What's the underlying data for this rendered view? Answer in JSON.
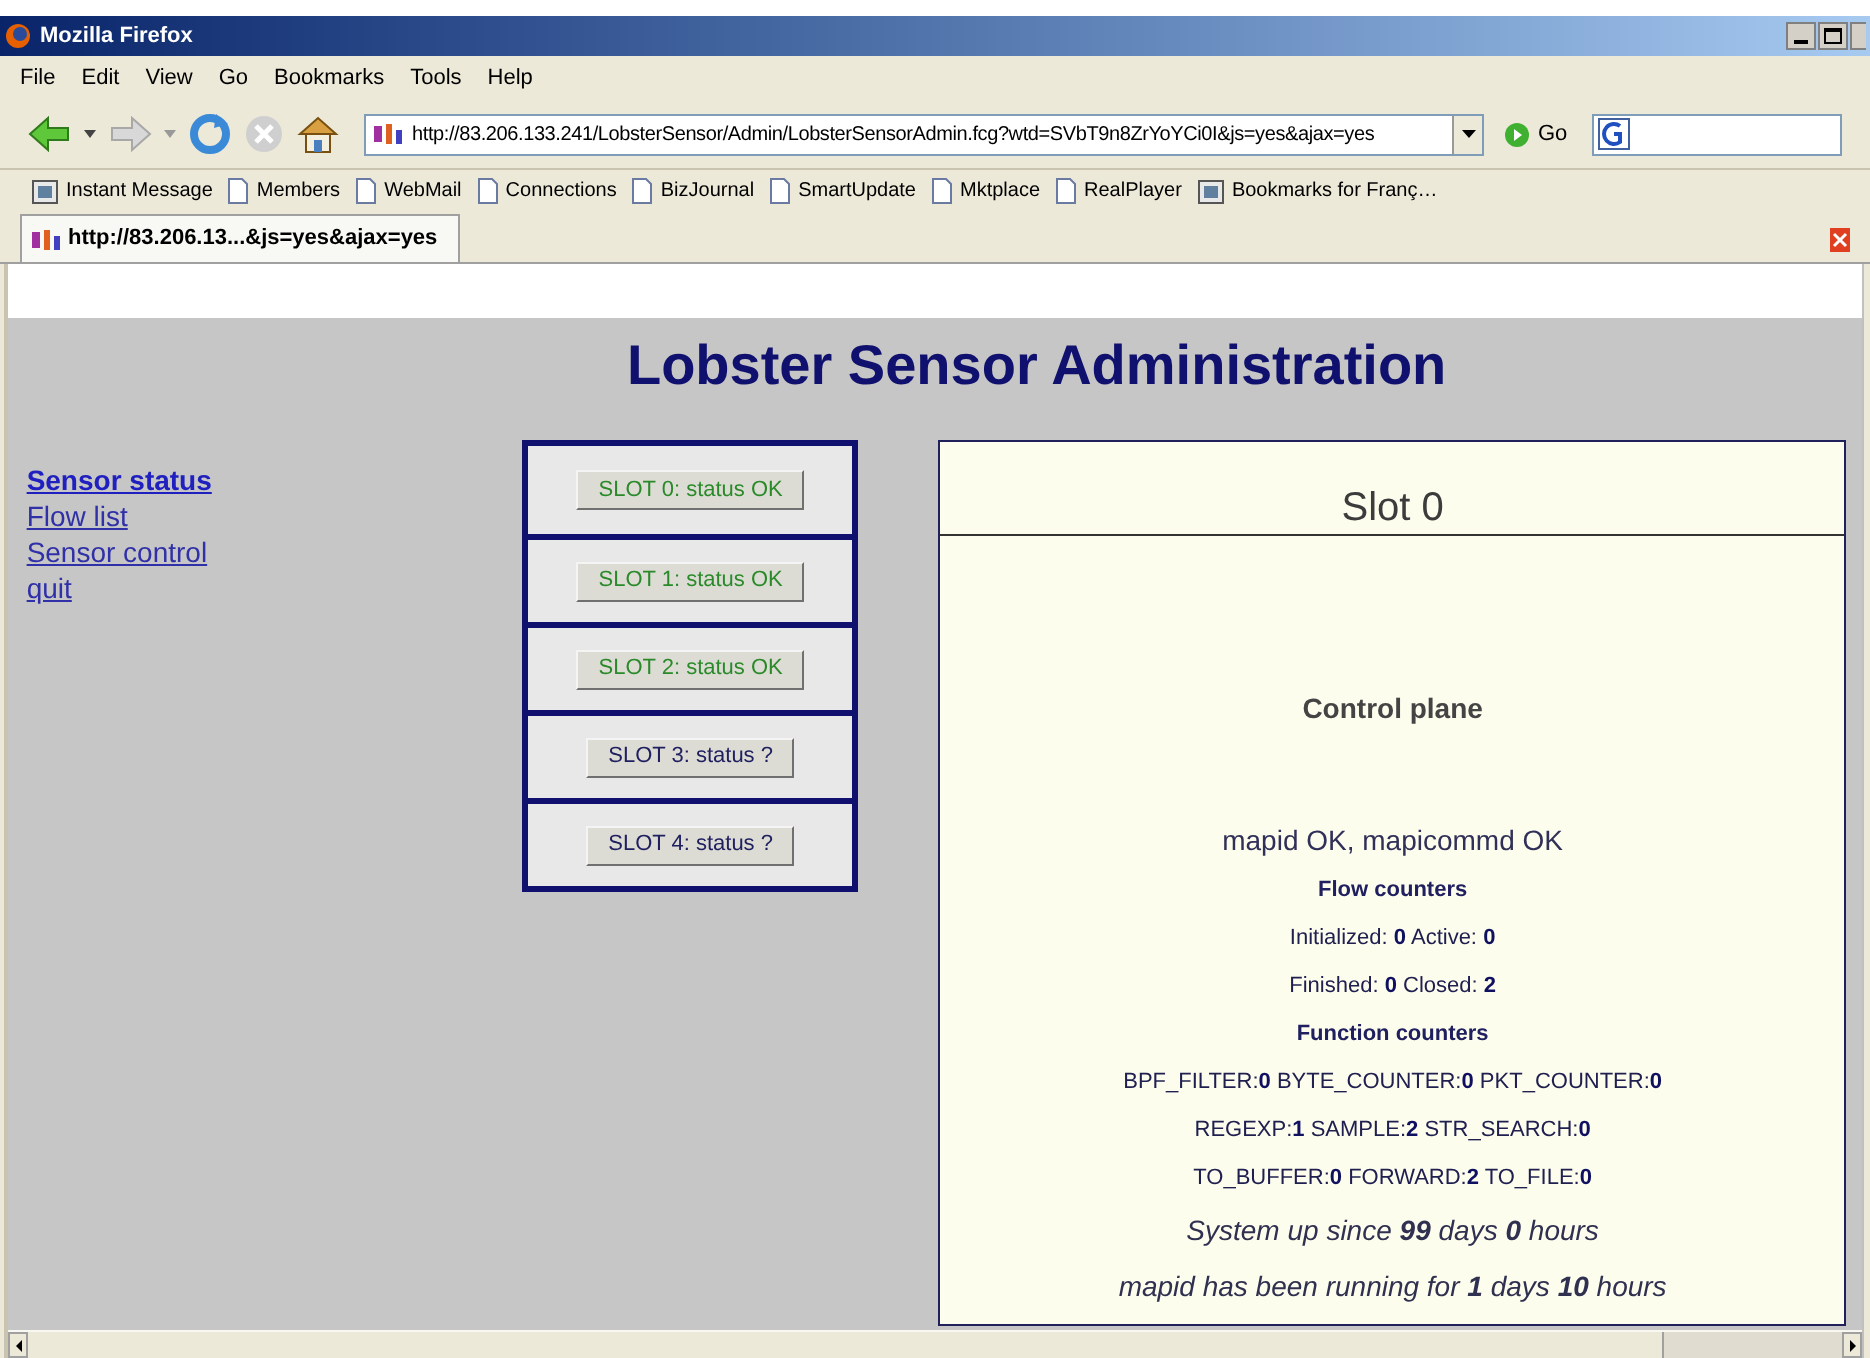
{
  "window": {
    "title": "Mozilla Firefox"
  },
  "menu": [
    "File",
    "Edit",
    "View",
    "Go",
    "Bookmarks",
    "Tools",
    "Help"
  ],
  "address": {
    "value": "http://83.206.133.241/LobsterSensor/Admin/LobsterSensorAdmin.fcg?wtd=SVbT9n8ZrYoYCi0I&js=yes&ajax=yes"
  },
  "go_label": "Go",
  "bookmarks": [
    {
      "label": "Instant Message",
      "kind": "app"
    },
    {
      "label": "Members",
      "kind": "page"
    },
    {
      "label": "WebMail",
      "kind": "page"
    },
    {
      "label": "Connections",
      "kind": "page"
    },
    {
      "label": "BizJournal",
      "kind": "page"
    },
    {
      "label": "SmartUpdate",
      "kind": "page"
    },
    {
      "label": "Mktplace",
      "kind": "page"
    },
    {
      "label": "RealPlayer",
      "kind": "page"
    },
    {
      "label": "Bookmarks for Franç…",
      "kind": "app"
    }
  ],
  "tabs": [
    {
      "label": "http://83.206.13...&js=yes&ajax=yes",
      "selected": true
    }
  ],
  "page": {
    "heading": "Lobster Sensor Administration",
    "nav": [
      {
        "label": "Sensor status",
        "selected": true
      },
      {
        "label": "Flow list",
        "selected": false
      },
      {
        "label": "Sensor control",
        "selected": false
      },
      {
        "label": "quit",
        "selected": false
      }
    ],
    "slots": [
      {
        "label": "SLOT 0: status OK",
        "kind": "ok"
      },
      {
        "label": "SLOT 1: status OK",
        "kind": "ok"
      },
      {
        "label": "SLOT 2: status OK",
        "kind": "ok"
      },
      {
        "label": "SLOT 3: status ?",
        "kind": "unknown"
      },
      {
        "label": "SLOT 4: status ?",
        "kind": "unknown"
      }
    ],
    "panel": {
      "title": "Slot 0",
      "section": "Control plane",
      "lines": [
        {
          "kind": "status",
          "text": "mapid OK, mapicommd OK"
        },
        {
          "kind": "heading",
          "text": "Flow counters"
        },
        {
          "kind": "counter",
          "text": "Initialized: **0** Active: **0**"
        },
        {
          "kind": "counter",
          "text": "Finished: **0** Closed: **2**"
        },
        {
          "kind": "heading",
          "text": "Function counters"
        },
        {
          "kind": "counter",
          "text": "BPF_FILTER:**0** BYTE_COUNTER:**0** PKT_COUNTER:**0**"
        },
        {
          "kind": "counter",
          "text": "REGEXP:**1** SAMPLE:**2** STR_SEARCH:**0**"
        },
        {
          "kind": "counter",
          "text": "TO_BUFFER:**0** FORWARD:**2** TO_FILE:**0**"
        },
        {
          "kind": "uptime",
          "text": "System up since **99** days **0** hours"
        },
        {
          "kind": "uptime",
          "text": "mapid has been running for **1** days **10** hours"
        }
      ]
    }
  }
}
